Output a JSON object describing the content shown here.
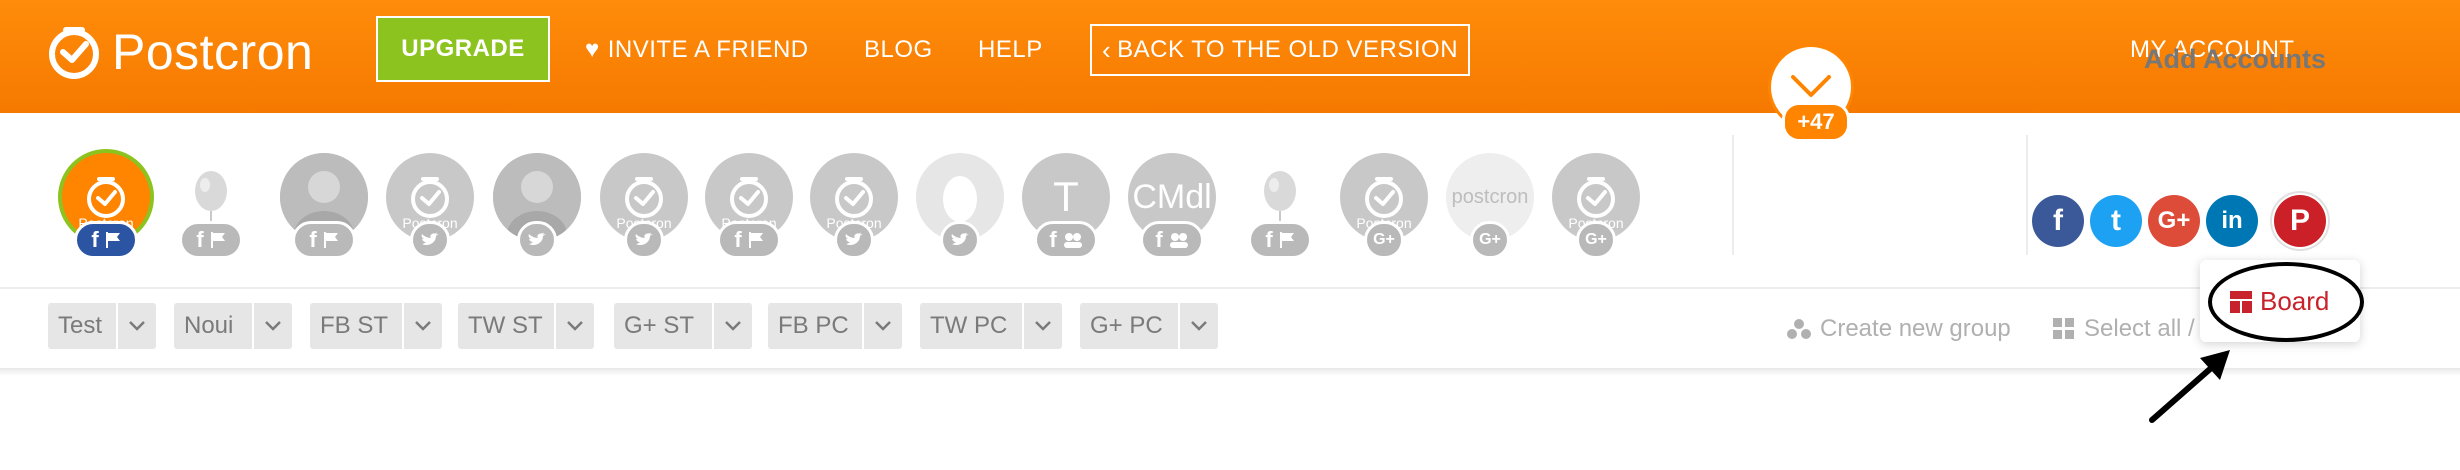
{
  "header": {
    "brand": "Postcron",
    "upgrade_label": "UPGRADE",
    "invite_label": "INVITE A FRIEND",
    "blog_label": "BLOG",
    "help_label": "HELP",
    "back_label": "BACK TO THE OLD VERSION",
    "account_label": "MY ACCOUNT"
  },
  "accounts": {
    "avatars": [
      {
        "kind": "postcron",
        "badge": [
          "facebook",
          "flag"
        ],
        "active": true,
        "label": "Postcron"
      },
      {
        "kind": "balloon",
        "badge": [
          "facebook",
          "flag"
        ],
        "active": false
      },
      {
        "kind": "photo",
        "badge": [
          "facebook",
          "flag"
        ],
        "active": false
      },
      {
        "kind": "postcron",
        "badge": [
          "twitter"
        ],
        "active": false,
        "label": "Postcron"
      },
      {
        "kind": "photo",
        "badge": [
          "twitter"
        ],
        "active": false
      },
      {
        "kind": "postcron",
        "badge": [
          "twitter"
        ],
        "active": false,
        "label": "Postcron"
      },
      {
        "kind": "postcron",
        "badge": [
          "facebook",
          "flag"
        ],
        "active": false,
        "label": "Postcron"
      },
      {
        "kind": "postcron",
        "badge": [
          "twitter"
        ],
        "active": false,
        "label": "Postcron"
      },
      {
        "kind": "egg",
        "badge": [
          "twitter"
        ],
        "active": false
      },
      {
        "kind": "letter",
        "text": "T",
        "badge": [
          "facebook",
          "group"
        ],
        "active": false
      },
      {
        "kind": "letter",
        "text": "CMdl",
        "badge": [
          "facebook",
          "group"
        ],
        "active": false
      },
      {
        "kind": "balloon",
        "badge": [
          "facebook",
          "flag"
        ],
        "active": false
      },
      {
        "kind": "postcron",
        "badge": [
          "google-plus"
        ],
        "active": false,
        "label": "Postcron"
      },
      {
        "kind": "wordmark",
        "text": "postcron",
        "badge": [
          "google-plus"
        ],
        "active": false
      },
      {
        "kind": "postcron",
        "badge": [
          "google-plus"
        ],
        "active": false,
        "label": "Postcron"
      }
    ],
    "more_count": "+47",
    "add_title": "Add Accounts",
    "networks": [
      {
        "name": "facebook",
        "color": "#3b5998",
        "glyph": "f"
      },
      {
        "name": "twitter",
        "color": "#1da1f2",
        "glyph": "t"
      },
      {
        "name": "google-plus",
        "color": "#dd4b39",
        "glyph": "G+"
      },
      {
        "name": "linkedin",
        "color": "#0077b5",
        "glyph": "in"
      },
      {
        "name": "pinterest",
        "color": "#cb2027",
        "glyph": "P"
      }
    ]
  },
  "groups": {
    "items": [
      "Test",
      "Noui",
      "FB ST",
      "TW ST",
      "G+ ST",
      "FB PC",
      "TW PC",
      "G+ PC"
    ],
    "create_label": "Create new group",
    "select_all_label": "Select all /"
  },
  "popup": {
    "board_label": "Board"
  },
  "colors": {
    "brand_orange": "#f98100",
    "upgrade_green": "#8dc31e",
    "pinterest_red": "#c8232c"
  }
}
